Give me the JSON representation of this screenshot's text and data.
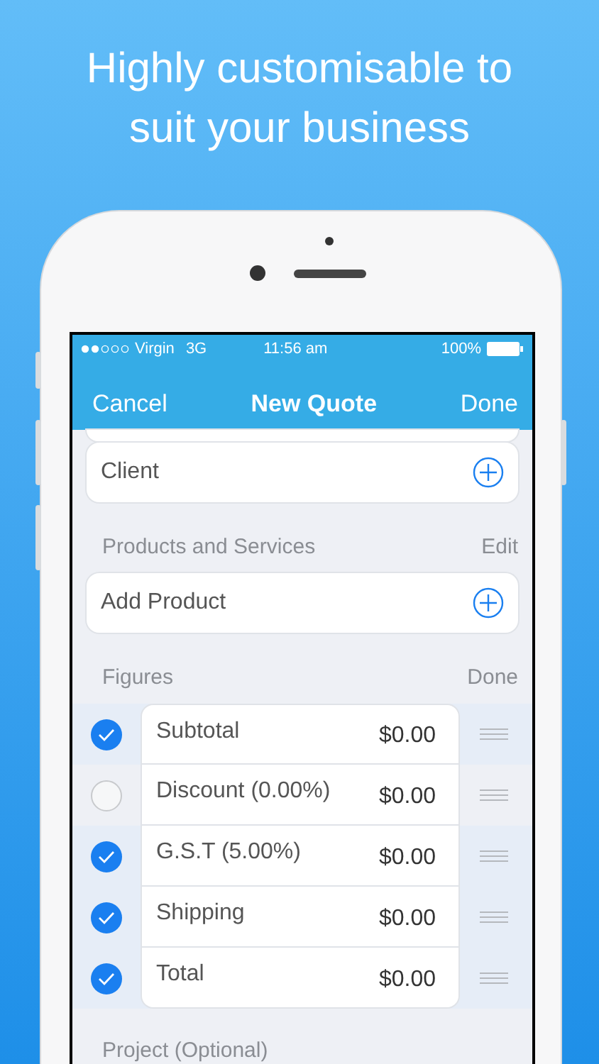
{
  "headline": "Highly customisable to suit your business",
  "status_bar": {
    "carrier": "Virgin",
    "network": "3G",
    "time": "11:56 am",
    "battery": "100%"
  },
  "nav_bar": {
    "left": "Cancel",
    "title": "New Quote",
    "right": "Done"
  },
  "client": {
    "label": "Client"
  },
  "products": {
    "header": "Products and Services",
    "action": "Edit",
    "add_label": "Add Product"
  },
  "figures": {
    "header": "Figures",
    "action": "Done",
    "rows": [
      {
        "label": "Subtotal",
        "amount": "$0.00",
        "checked": true
      },
      {
        "label": "Discount (0.00%)",
        "amount": "$0.00",
        "checked": false
      },
      {
        "label": "G.S.T (5.00%)",
        "amount": "$0.00",
        "checked": true
      },
      {
        "label": "Shipping",
        "amount": "$0.00",
        "checked": true
      },
      {
        "label": "Total",
        "amount": "$0.00",
        "checked": true
      }
    ]
  },
  "project": {
    "header": "Project (Optional)"
  }
}
